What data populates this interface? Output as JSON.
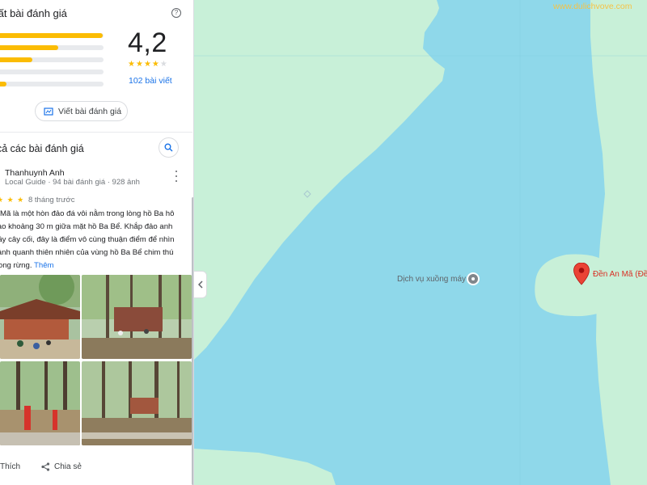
{
  "panel": {
    "header_title": "tất bài đánh giá",
    "rating": "4,2",
    "rating_stars": 4,
    "review_count": "102 bài viết",
    "distribution": [
      0.99,
      0.56,
      0.31,
      0.0,
      0.06
    ],
    "write_review_label": "Viết bài đánh giá",
    "section_title": "cả các bài đánh giá",
    "review": {
      "author": "Thanhuynh Anh",
      "meta": "Local Guide · 94 bài đánh giá · 928 ảnh",
      "time": "8 tháng trước",
      "stars": 4,
      "text": "n Mã là một hòn đảo đá vôi nằm trong lòng hồ Ba hô cao khoảng 30 m giữa mặt hồ Ba Bể. Khắp đảo anh đầy cây cối, đây là điểm vô cùng thuận điểm để nhìn cảnh quanh thiên nhiên của vùng hồ Ba Bể chim thú trong rừng.",
      "more_label": "Thêm"
    },
    "like_label": "Thích",
    "share_label": "Chia sẻ"
  },
  "map": {
    "watermark": "www.dulichvove.com",
    "poi_label": "Dịch vụ xuồng máy",
    "place_label": "Đền An Mã (Đền"
  },
  "colors": {
    "star": "#fbbc04",
    "link": "#1a73e8",
    "water": "#8fd8ea",
    "land": "#c8f0d8",
    "pin": "#ea4335"
  }
}
